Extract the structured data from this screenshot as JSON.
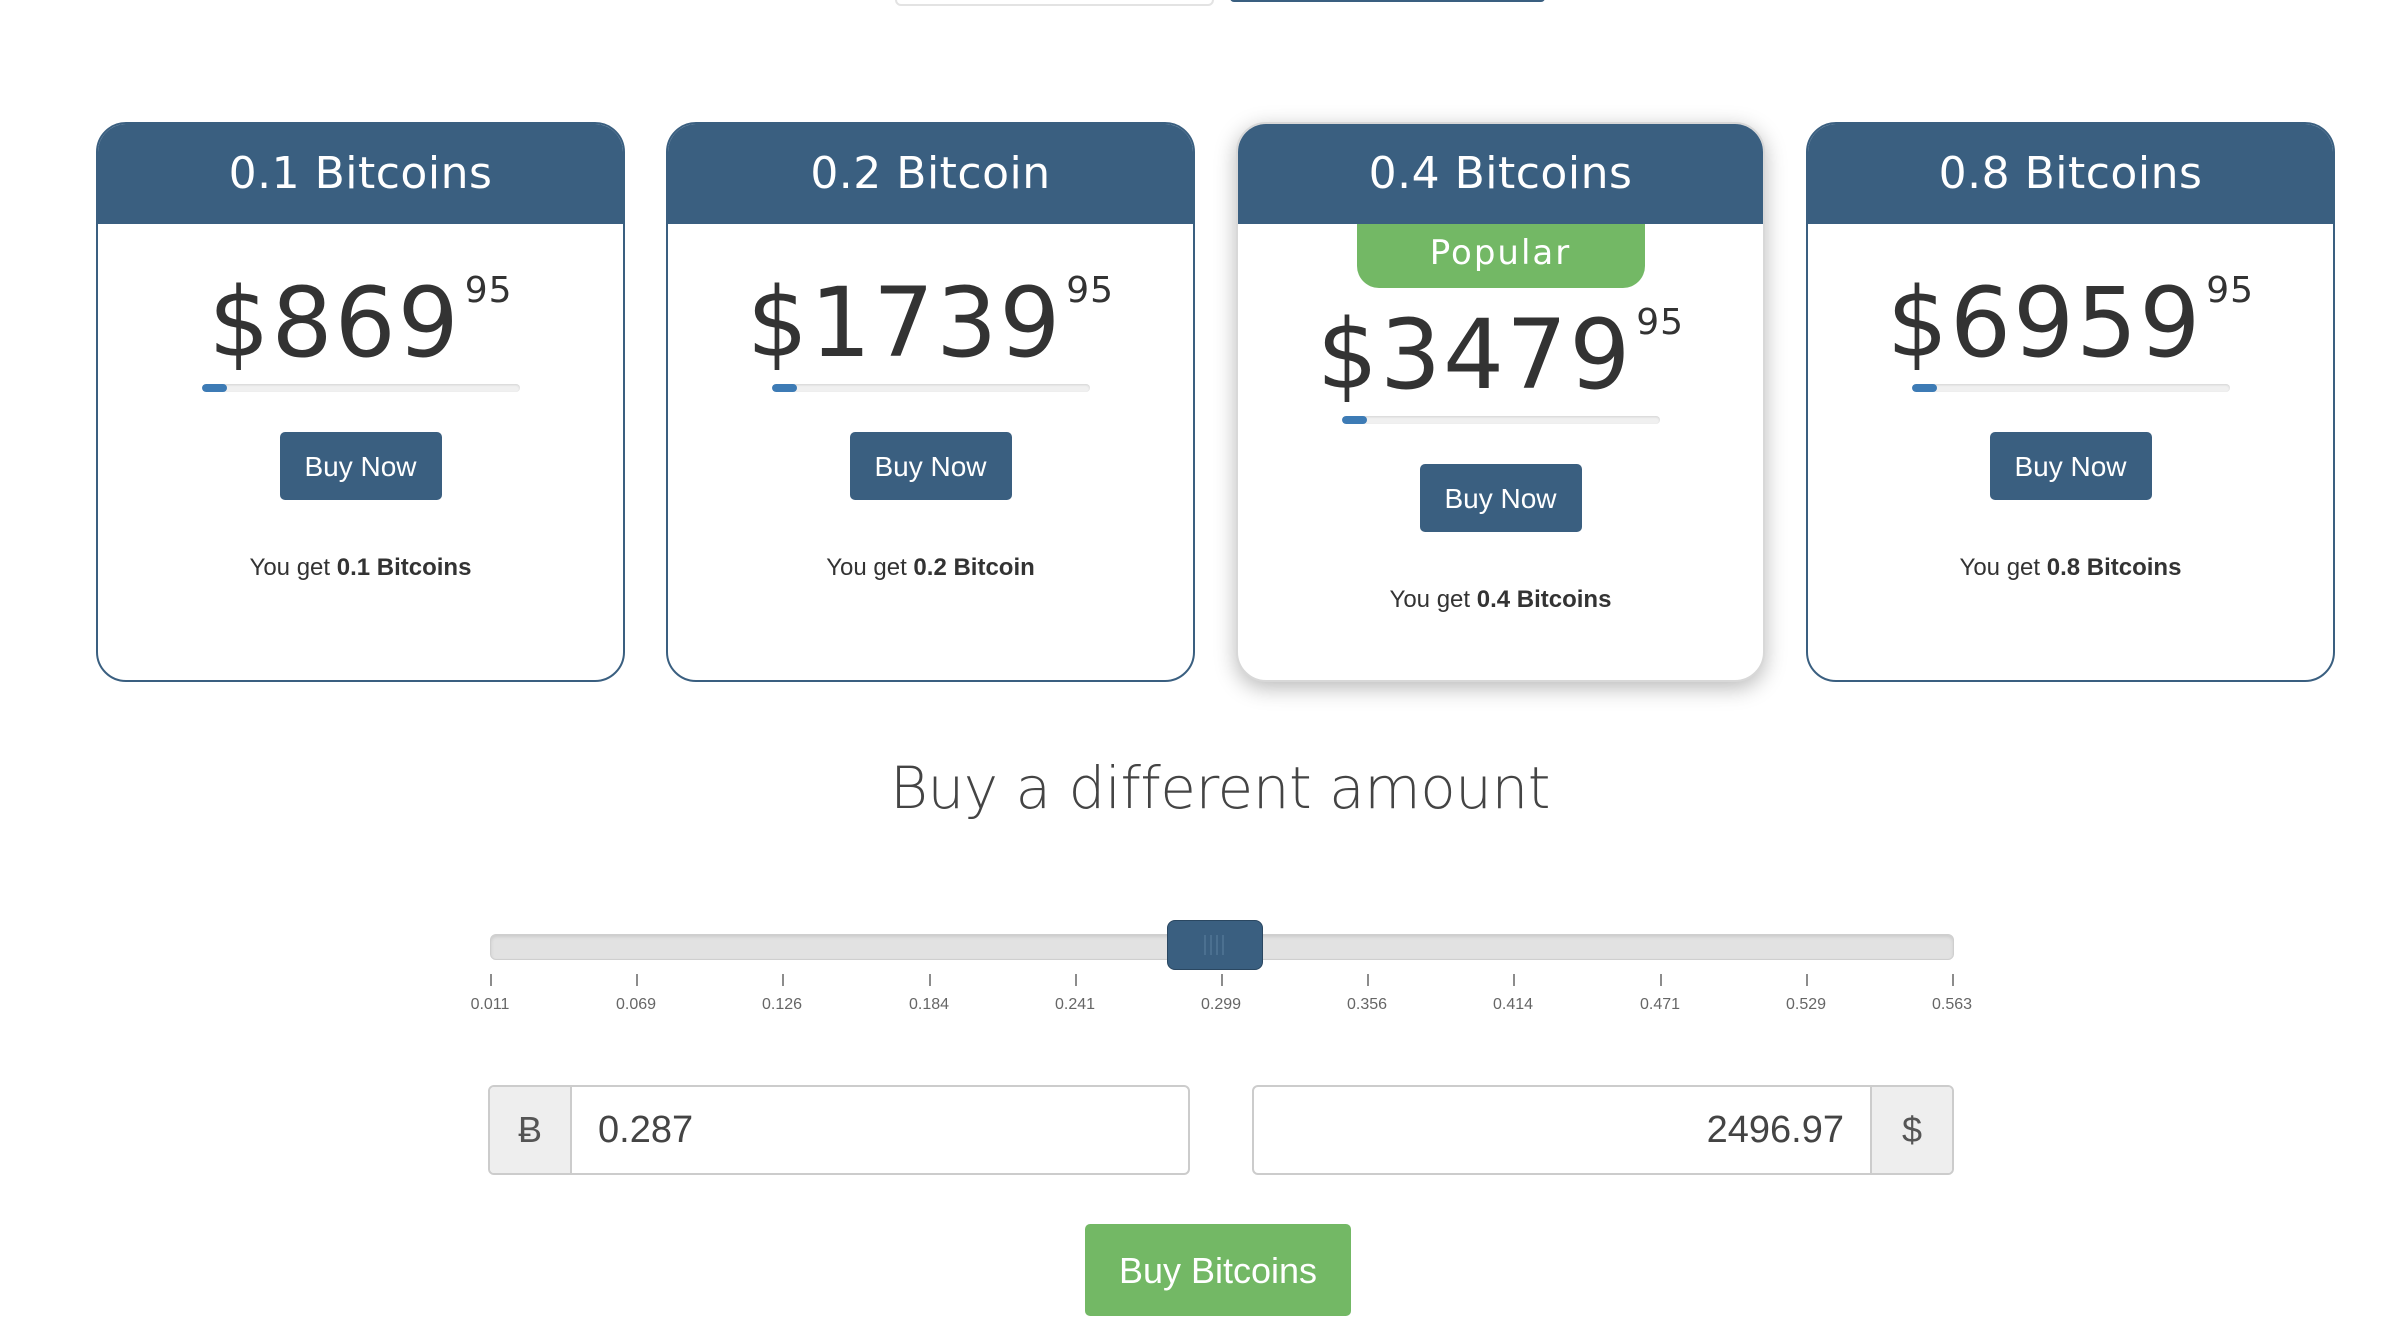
{
  "plans": [
    {
      "title": "0.1 Bitcoins",
      "price_main": "$869",
      "price_cents": "95",
      "progress": 0.08,
      "button_label": "Buy Now",
      "you_get_prefix": "You get",
      "you_get_amount": "0.1 Bitcoins",
      "featured": false
    },
    {
      "title": "0.2 Bitcoin",
      "price_main": "$1739",
      "price_cents": "95",
      "progress": 0.08,
      "button_label": "Buy Now",
      "you_get_prefix": "You get",
      "you_get_amount": "0.2 Bitcoin",
      "featured": false
    },
    {
      "title": "0.4 Bitcoins",
      "badge": "Popular",
      "price_main": "$3479",
      "price_cents": "95",
      "progress": 0.08,
      "button_label": "Buy Now",
      "you_get_prefix": "You get",
      "you_get_amount": "0.4 Bitcoins",
      "featured": true
    },
    {
      "title": "0.8 Bitcoins",
      "price_main": "$6959",
      "price_cents": "95",
      "progress": 0.08,
      "button_label": "Buy Now",
      "you_get_prefix": "You get",
      "you_get_amount": "0.8 Bitcoins",
      "featured": false
    }
  ],
  "custom": {
    "title": "Buy a different amount",
    "slider": {
      "ticks": [
        "0.011",
        "0.069",
        "0.126",
        "0.184",
        "0.241",
        "0.299",
        "0.356",
        "0.414",
        "0.471",
        "0.529",
        "0.563"
      ],
      "value": 0.287
    },
    "btc_symbol": "Ƀ",
    "btc_value": "0.287",
    "usd_value": "2496.97",
    "usd_symbol": "$",
    "submit_label": "Buy Bitcoins"
  },
  "colors": {
    "primary": "#3a5f80",
    "accent_green": "#73b865",
    "progress_fill": "#3d7bb5"
  }
}
